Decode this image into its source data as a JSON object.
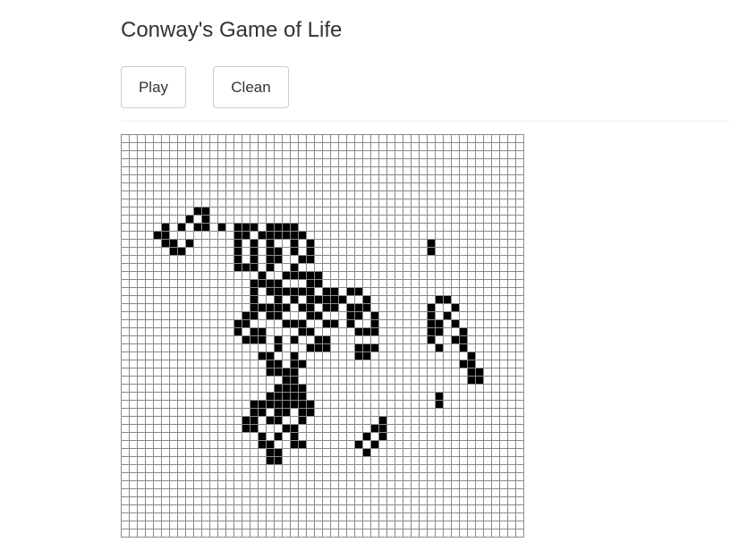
{
  "header": {
    "title": "Conway's Game of Life"
  },
  "controls": {
    "play_label": "Play",
    "clean_label": "Clean"
  },
  "board": {
    "columns": 50,
    "rows": 50,
    "alive_color": "#000000",
    "dead_color": "#ffffff",
    "grid_color": "#8a8a8a",
    "alive_cells": [
      [
        9,
        9
      ],
      [
        10,
        9
      ],
      [
        8,
        10
      ],
      [
        10,
        10
      ],
      [
        5,
        11
      ],
      [
        7,
        11
      ],
      [
        9,
        11
      ],
      [
        10,
        11
      ],
      [
        12,
        11
      ],
      [
        14,
        11
      ],
      [
        15,
        11
      ],
      [
        16,
        11
      ],
      [
        18,
        11
      ],
      [
        19,
        11
      ],
      [
        20,
        11
      ],
      [
        21,
        11
      ],
      [
        4,
        12
      ],
      [
        5,
        12
      ],
      [
        14,
        12
      ],
      [
        15,
        12
      ],
      [
        17,
        12
      ],
      [
        18,
        12
      ],
      [
        19,
        12
      ],
      [
        20,
        12
      ],
      [
        21,
        12
      ],
      [
        22,
        12
      ],
      [
        5,
        13
      ],
      [
        6,
        13
      ],
      [
        8,
        13
      ],
      [
        14,
        13
      ],
      [
        16,
        13
      ],
      [
        18,
        13
      ],
      [
        21,
        13
      ],
      [
        23,
        13
      ],
      [
        38,
        13
      ],
      [
        6,
        14
      ],
      [
        7,
        14
      ],
      [
        14,
        14
      ],
      [
        16,
        14
      ],
      [
        18,
        14
      ],
      [
        19,
        14
      ],
      [
        21,
        14
      ],
      [
        23,
        14
      ],
      [
        38,
        14
      ],
      [
        14,
        15
      ],
      [
        16,
        15
      ],
      [
        18,
        15
      ],
      [
        19,
        15
      ],
      [
        22,
        15
      ],
      [
        23,
        15
      ],
      [
        14,
        16
      ],
      [
        15,
        16
      ],
      [
        16,
        16
      ],
      [
        18,
        16
      ],
      [
        21,
        16
      ],
      [
        17,
        17
      ],
      [
        20,
        17
      ],
      [
        21,
        17
      ],
      [
        22,
        17
      ],
      [
        23,
        17
      ],
      [
        24,
        17
      ],
      [
        16,
        18
      ],
      [
        17,
        18
      ],
      [
        18,
        18
      ],
      [
        19,
        18
      ],
      [
        23,
        18
      ],
      [
        24,
        18
      ],
      [
        16,
        19
      ],
      [
        18,
        19
      ],
      [
        19,
        19
      ],
      [
        20,
        19
      ],
      [
        21,
        19
      ],
      [
        22,
        19
      ],
      [
        23,
        19
      ],
      [
        25,
        19
      ],
      [
        26,
        19
      ],
      [
        28,
        19
      ],
      [
        29,
        19
      ],
      [
        16,
        20
      ],
      [
        19,
        20
      ],
      [
        21,
        20
      ],
      [
        23,
        20
      ],
      [
        24,
        20
      ],
      [
        25,
        20
      ],
      [
        26,
        20
      ],
      [
        27,
        20
      ],
      [
        30,
        20
      ],
      [
        39,
        20
      ],
      [
        40,
        20
      ],
      [
        16,
        21
      ],
      [
        17,
        21
      ],
      [
        18,
        21
      ],
      [
        19,
        21
      ],
      [
        20,
        21
      ],
      [
        22,
        21
      ],
      [
        23,
        21
      ],
      [
        25,
        21
      ],
      [
        26,
        21
      ],
      [
        28,
        21
      ],
      [
        29,
        21
      ],
      [
        30,
        21
      ],
      [
        38,
        21
      ],
      [
        41,
        21
      ],
      [
        15,
        22
      ],
      [
        16,
        22
      ],
      [
        18,
        22
      ],
      [
        19,
        22
      ],
      [
        23,
        22
      ],
      [
        24,
        22
      ],
      [
        28,
        22
      ],
      [
        29,
        22
      ],
      [
        31,
        22
      ],
      [
        38,
        22
      ],
      [
        40,
        22
      ],
      [
        14,
        23
      ],
      [
        15,
        23
      ],
      [
        20,
        23
      ],
      [
        21,
        23
      ],
      [
        22,
        23
      ],
      [
        25,
        23
      ],
      [
        26,
        23
      ],
      [
        28,
        23
      ],
      [
        31,
        23
      ],
      [
        38,
        23
      ],
      [
        39,
        23
      ],
      [
        41,
        23
      ],
      [
        14,
        24
      ],
      [
        16,
        24
      ],
      [
        17,
        24
      ],
      [
        22,
        24
      ],
      [
        23,
        24
      ],
      [
        29,
        24
      ],
      [
        30,
        24
      ],
      [
        31,
        24
      ],
      [
        38,
        24
      ],
      [
        39,
        24
      ],
      [
        42,
        24
      ],
      [
        15,
        25
      ],
      [
        16,
        25
      ],
      [
        17,
        25
      ],
      [
        19,
        25
      ],
      [
        21,
        25
      ],
      [
        24,
        25
      ],
      [
        25,
        25
      ],
      [
        38,
        25
      ],
      [
        41,
        25
      ],
      [
        42,
        25
      ],
      [
        19,
        26
      ],
      [
        23,
        26
      ],
      [
        24,
        26
      ],
      [
        25,
        26
      ],
      [
        29,
        26
      ],
      [
        30,
        26
      ],
      [
        31,
        26
      ],
      [
        39,
        26
      ],
      [
        42,
        26
      ],
      [
        17,
        27
      ],
      [
        18,
        27
      ],
      [
        21,
        27
      ],
      [
        29,
        27
      ],
      [
        30,
        27
      ],
      [
        43,
        27
      ],
      [
        18,
        28
      ],
      [
        19,
        28
      ],
      [
        21,
        28
      ],
      [
        22,
        28
      ],
      [
        42,
        28
      ],
      [
        43,
        28
      ],
      [
        18,
        29
      ],
      [
        19,
        29
      ],
      [
        20,
        29
      ],
      [
        21,
        29
      ],
      [
        43,
        29
      ],
      [
        44,
        29
      ],
      [
        20,
        30
      ],
      [
        21,
        30
      ],
      [
        43,
        30
      ],
      [
        44,
        30
      ],
      [
        19,
        31
      ],
      [
        20,
        31
      ],
      [
        21,
        31
      ],
      [
        22,
        31
      ],
      [
        18,
        32
      ],
      [
        19,
        32
      ],
      [
        20,
        32
      ],
      [
        21,
        32
      ],
      [
        22,
        32
      ],
      [
        39,
        32
      ],
      [
        16,
        33
      ],
      [
        17,
        33
      ],
      [
        18,
        33
      ],
      [
        19,
        33
      ],
      [
        20,
        33
      ],
      [
        21,
        33
      ],
      [
        22,
        33
      ],
      [
        23,
        33
      ],
      [
        39,
        33
      ],
      [
        16,
        34
      ],
      [
        17,
        34
      ],
      [
        19,
        34
      ],
      [
        20,
        34
      ],
      [
        22,
        34
      ],
      [
        23,
        34
      ],
      [
        15,
        35
      ],
      [
        16,
        35
      ],
      [
        18,
        35
      ],
      [
        19,
        35
      ],
      [
        22,
        35
      ],
      [
        32,
        35
      ],
      [
        15,
        36
      ],
      [
        16,
        36
      ],
      [
        20,
        36
      ],
      [
        21,
        36
      ],
      [
        31,
        36
      ],
      [
        32,
        36
      ],
      [
        17,
        37
      ],
      [
        19,
        37
      ],
      [
        21,
        37
      ],
      [
        30,
        37
      ],
      [
        32,
        37
      ],
      [
        17,
        38
      ],
      [
        18,
        38
      ],
      [
        21,
        38
      ],
      [
        22,
        38
      ],
      [
        29,
        38
      ],
      [
        31,
        38
      ],
      [
        18,
        39
      ],
      [
        19,
        39
      ],
      [
        30,
        39
      ],
      [
        18,
        40
      ],
      [
        19,
        40
      ]
    ]
  }
}
